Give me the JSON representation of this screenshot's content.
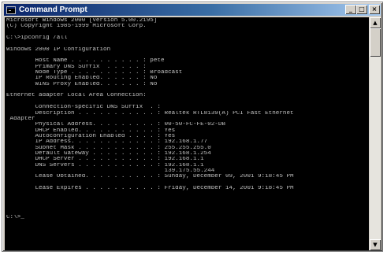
{
  "window": {
    "title": "Command Prompt",
    "buttons": {
      "minimize": "_",
      "maximize": "□",
      "close": "×"
    }
  },
  "scrollbar": {
    "up_arrow": "▲",
    "down_arrow": "▼"
  },
  "console": {
    "lines": [
      "Microsoft Windows 2000 [Version 5.00.2195]",
      "(C) Copyright 1985-1999 Microsoft Corp.",
      "",
      "C:\\>ipconfig /all",
      "",
      "Windows 2000 IP Configuration",
      "",
      "        Host Name . . . . . . . . . . : pete",
      "        Primary DNS Suffix  . . . . . :",
      "        Node Type . . . . . . . . . . : Broadcast",
      "        IP Routing Enabled. . . . . . : No",
      "        WINS Proxy Enabled. . . . . . : No",
      "",
      "Ethernet adapter Local Area Connection:",
      "",
      "        Connection-specific DNS Suffix  . :",
      "        Description . . . . . . . . . . . : Realtek RTL8139(A) PCI Fast Ethernet",
      " Adapter",
      "        Physical Address. . . . . . . . . : 00-50-FC-FE-02-DB",
      "        DHCP Enabled. . . . . . . . . . . : Yes",
      "        Autoconfiguration Enabled . . . . : Yes",
      "        IP Address. . . . . . . . . . . . : 192.168.1.77",
      "        Subnet Mask . . . . . . . . . . . : 255.255.255.0",
      "        Default Gateway . . . . . . . . . : 192.168.1.254",
      "        DHCP Server . . . . . . . . . . . : 192.168.1.1",
      "        DNS Servers . . . . . . . . . . . : 192.168.1.1",
      "                                            139.175.55.244",
      "        Lease Obtained. . . . . . . . . . : Sunday, December 09, 2001 9:18:45 PM",
      "",
      "        Lease Expires . . . . . . . . . . : Friday, December 14, 2001 9:18:45 PM",
      "",
      "",
      "",
      "",
      "C:\\>_"
    ]
  }
}
